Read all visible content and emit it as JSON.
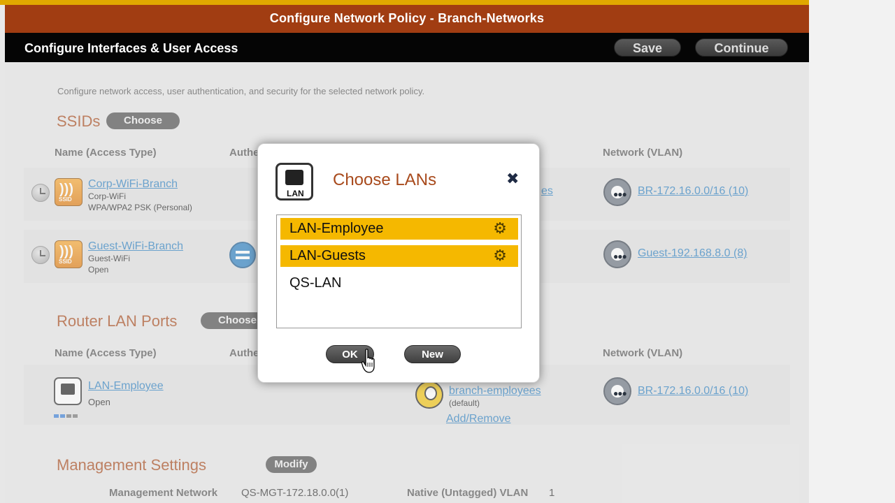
{
  "header": {
    "title": "Configure Network Policy - Branch-Networks"
  },
  "subheader": {
    "title": "Configure Interfaces & User Access",
    "save_label": "Save",
    "continue_label": "Continue"
  },
  "description": "Configure network access, user authentication, and security for the selected network policy.",
  "ssids": {
    "section_title": "SSIDs",
    "choose_label": "Choose",
    "col_name": "Name (Access Type)",
    "col_auth": "Authe",
    "col_network": "Network (VLAN)",
    "rows": [
      {
        "name": "Corp-WiFi-Branch",
        "sub1": "Corp-WiFi",
        "sub2": "WPA/WPA2 PSK (Personal)",
        "network": "BR-172.16.0.0/16 (10)",
        "partial_link": "es"
      },
      {
        "name": "Guest-WiFi-Branch",
        "sub1": "Guest-WiFi",
        "sub2": "Open",
        "network": "Guest-192.168.8.0 (8)"
      }
    ]
  },
  "router_lan": {
    "section_title": "Router LAN Ports",
    "choose_label": "Choose",
    "col_name": "Name (Access Type)",
    "col_auth": "Authe",
    "col_network": "Network (VLAN)",
    "row": {
      "name": "LAN-Employee",
      "sub": "Open",
      "user_profile": "branch-employees",
      "user_profile_sub": "(default)",
      "add_remove": "Add/Remove",
      "network": "BR-172.16.0.0/16 (10)"
    }
  },
  "management": {
    "section_title": "Management Settings",
    "modify_label": "Modify",
    "mgmt_network_label": "Management Network",
    "mgmt_network_value": "QS-MGT-172.18.0.0(1)",
    "native_vlan_label": "Native (Untagged) VLAN",
    "native_vlan_value": "1"
  },
  "dialog": {
    "icon_caption": "LAN",
    "title": "Choose LANs",
    "close_glyph": "✖",
    "items": [
      {
        "label": "LAN-Employee",
        "selected": true
      },
      {
        "label": "LAN-Guests",
        "selected": true
      },
      {
        "label": "QS-LAN",
        "selected": false
      }
    ],
    "ok_label": "OK",
    "new_label": "New"
  },
  "icons": {
    "ssid_caption": "SSID",
    "lan_caption": "LAN"
  },
  "colors": {
    "brand": "#a13d12",
    "accent_gold": "#f5b800",
    "link": "#2a7fc0",
    "section": "#a84a1c"
  }
}
